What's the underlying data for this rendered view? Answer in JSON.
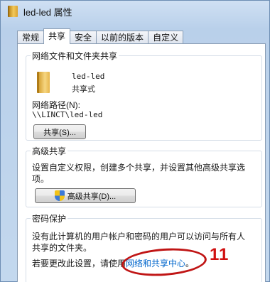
{
  "window": {
    "title": "led-led 属性"
  },
  "tabs": [
    "常规",
    "共享",
    "安全",
    "以前的版本",
    "自定义"
  ],
  "share_group": {
    "title": "网络文件和文件夹共享",
    "folder_name": "led-led",
    "status": "共享式",
    "path_label": "网络路径(N):",
    "path": "\\\\LINCT\\led-led",
    "share_button": "共享(S)..."
  },
  "advanced_group": {
    "title": "高级共享",
    "desc": "设置自定义权限，创建多个共享，并设置其他高级共享选项。",
    "desc_line1": "设置自定义权限，创建多个共享，并设置其他高级共享选",
    "desc_line2": "项。",
    "button": "高级共享(D)..."
  },
  "password_group": {
    "title": "密码保护",
    "desc_line1": "没有此计算机的用户帐户和密码的用户可以访问与所有人",
    "desc_line2": "共享的文件夹。",
    "change_prefix": "若要更改此设置，请使用",
    "link": "网络和共享中心",
    "suffix": "。"
  },
  "annotation": {
    "label": "11",
    "color": "#d01010"
  }
}
